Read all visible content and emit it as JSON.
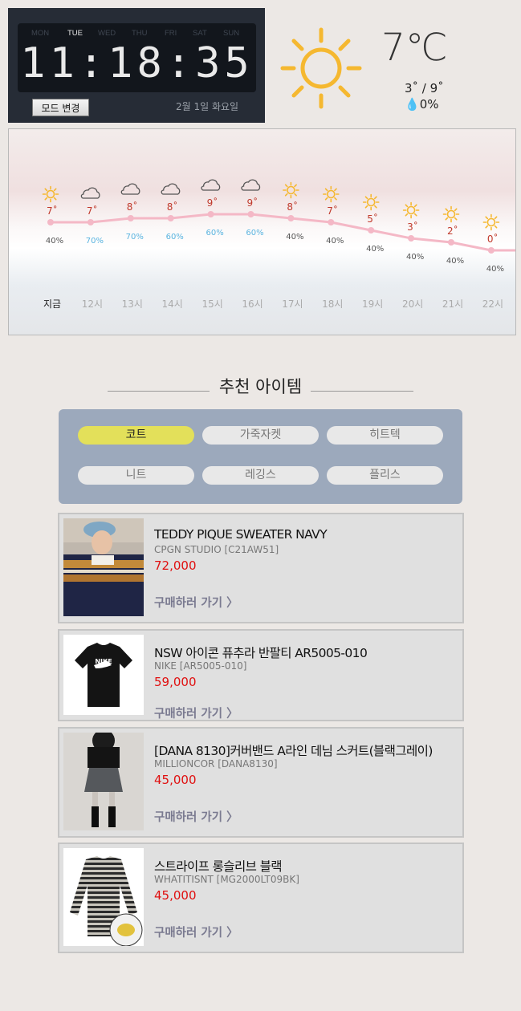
{
  "clock": {
    "days": [
      "MON",
      "TUE",
      "WED",
      "THU",
      "FRI",
      "SAT",
      "SUN"
    ],
    "active_day": "TUE",
    "time": "11:18:35",
    "mode_button": "모드 변경",
    "date": "2월 1일 화요일"
  },
  "current_weather": {
    "icon": "sun-icon",
    "temperature": "7℃",
    "range": "3˚ / 9˚",
    "rain_icon": "droplet-icon",
    "rain": "0%"
  },
  "forecast": {
    "hours": [
      {
        "time": "지금",
        "icon": "sun-icon",
        "temp": 7,
        "temp_label": "7˚",
        "rain": "40%",
        "rain_color": "#555555"
      },
      {
        "time": "12시",
        "icon": "cloud-icon",
        "temp": 7,
        "temp_label": "7˚",
        "rain": "70%",
        "rain_color": "#5ab4e0"
      },
      {
        "time": "13시",
        "icon": "cloud-icon",
        "temp": 8,
        "temp_label": "8˚",
        "rain": "70%",
        "rain_color": "#5ab4e0"
      },
      {
        "time": "14시",
        "icon": "cloud-icon",
        "temp": 8,
        "temp_label": "8˚",
        "rain": "60%",
        "rain_color": "#5ab4e0"
      },
      {
        "time": "15시",
        "icon": "cloud-icon",
        "temp": 9,
        "temp_label": "9˚",
        "rain": "60%",
        "rain_color": "#5ab4e0"
      },
      {
        "time": "16시",
        "icon": "cloud-icon",
        "temp": 9,
        "temp_label": "9˚",
        "rain": "60%",
        "rain_color": "#5ab4e0"
      },
      {
        "time": "17시",
        "icon": "sun-icon",
        "temp": 8,
        "temp_label": "8˚",
        "rain": "40%",
        "rain_color": "#555555"
      },
      {
        "time": "18시",
        "icon": "sun-icon",
        "temp": 7,
        "temp_label": "7˚",
        "rain": "40%",
        "rain_color": "#555555"
      },
      {
        "time": "19시",
        "icon": "sun-icon",
        "temp": 5,
        "temp_label": "5˚",
        "rain": "40%",
        "rain_color": "#555555"
      },
      {
        "time": "20시",
        "icon": "sun-icon",
        "temp": 3,
        "temp_label": "3˚",
        "rain": "40%",
        "rain_color": "#555555"
      },
      {
        "time": "21시",
        "icon": "sun-icon",
        "temp": 2,
        "temp_label": "2˚",
        "rain": "40%",
        "rain_color": "#555555"
      },
      {
        "time": "22시",
        "icon": "sun-icon",
        "temp": 0,
        "temp_label": "0˚",
        "rain": "40%",
        "rain_color": "#555555"
      }
    ],
    "colors": {
      "line": "#f4b8c6",
      "temp": "#c0392b",
      "sun": "#f5b830",
      "cloud": "#555555"
    }
  },
  "recommend": {
    "title": "추천 아이템",
    "tabs": [
      "코트",
      "가죽자켓",
      "히트텍",
      "니트",
      "레깅스",
      "플리스"
    ],
    "active_tab": "코트",
    "link_label": "구매하러 가기 〉",
    "items": [
      {
        "name": "TEDDY PIQUE SWEATER NAVY",
        "brand": "CPGN STUDIO [C21AW51]",
        "price": "72,000"
      },
      {
        "name": "NSW 아이콘 퓨추라 반팔티 AR5005-010",
        "brand": "NIKE [AR5005-010]",
        "price": "59,000"
      },
      {
        "name": "[DANA 8130]커버밴드 A라인 데님 스커트(블랙그레이)",
        "brand": "MILLIONCOR [DANA8130]",
        "price": "45,000"
      },
      {
        "name": "스트라이프 롱슬리브 블랙",
        "brand": "WHATITISNT [MG2000LT09BK]",
        "price": "45,000"
      }
    ]
  }
}
